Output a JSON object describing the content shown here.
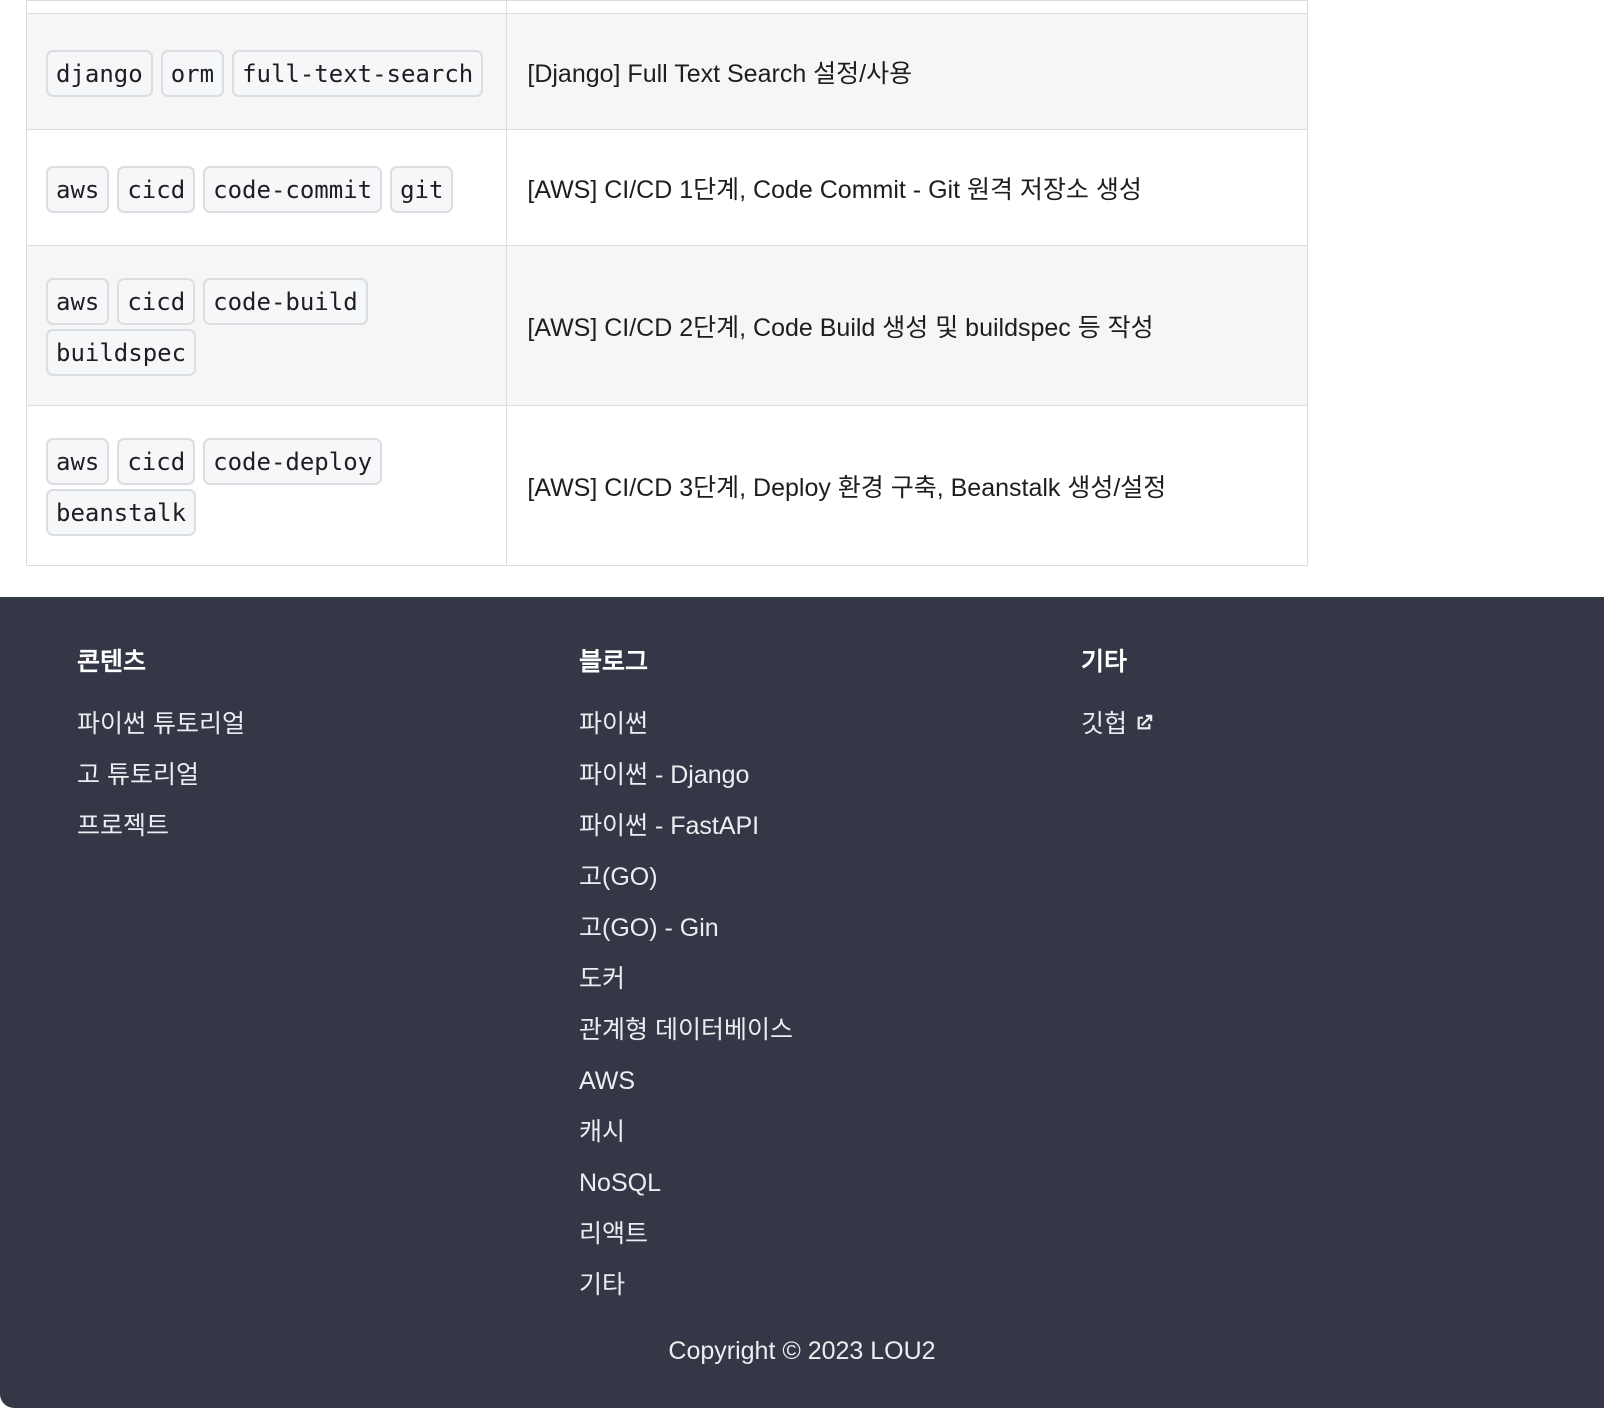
{
  "table": {
    "rows": [
      {
        "tags": [
          "django",
          "orm",
          "full-text-search"
        ],
        "title": "[Django] Full Text Search 설정/사용"
      },
      {
        "tags": [
          "aws",
          "cicd",
          "code-commit",
          "git"
        ],
        "title": "[AWS] CI/CD 1단계, Code Commit - Git 원격 저장소 생성"
      },
      {
        "tags": [
          "aws",
          "cicd",
          "code-build",
          "buildspec"
        ],
        "title": "[AWS] CI/CD 2단계, Code Build 생성 및 buildspec 등 작성"
      },
      {
        "tags": [
          "aws",
          "cicd",
          "code-deploy",
          "beanstalk"
        ],
        "title": "[AWS] CI/CD 3단계, Deploy 환경 구축, Beanstalk 생성/설정"
      }
    ]
  },
  "footer": {
    "columns": [
      {
        "heading": "콘텐츠",
        "links": [
          "파이썬 튜토리얼",
          "고 튜토리얼",
          "프로젝트"
        ]
      },
      {
        "heading": "블로그",
        "links": [
          "파이썬",
          "파이썬 - Django",
          "파이썬 - FastAPI",
          "고(GO)",
          "고(GO) - Gin",
          "도커",
          "관계형 데이터베이스",
          "AWS",
          "캐시",
          "NoSQL",
          "리액트",
          "기타"
        ]
      },
      {
        "heading": "기타",
        "links": [
          "깃헙"
        ],
        "link_icons": [
          "external-link-icon"
        ]
      }
    ],
    "copyright": "Copyright © 2023 LOU2"
  },
  "colors": {
    "footer_bg": "#343846",
    "tag_bg": "#f6f7f8",
    "tag_border": "#dadde1",
    "row_shade": "#f6f6f6"
  }
}
